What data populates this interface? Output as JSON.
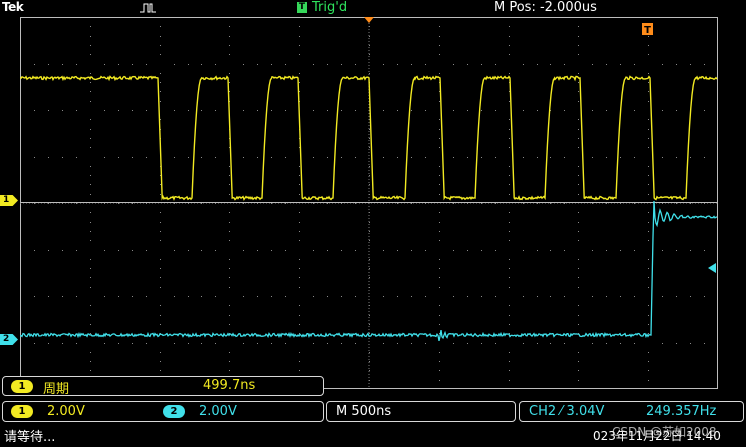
{
  "header": {
    "brand": "Tek",
    "acquisition_icon": "pulse-icon",
    "trigger_badge": "T",
    "trigger_status": "Trig'd",
    "horizontal_position": "M Pos: -2.000us"
  },
  "waveform": {
    "ch1_marker": "1",
    "ch2_marker": "2",
    "trigger_time_marker": "T",
    "ch1_color": "#f2ea22",
    "ch2_color": "#40e0ea"
  },
  "measurement": {
    "channel": "1",
    "label": "周期",
    "value": "499.7ns"
  },
  "channels": {
    "ch1_label": "1",
    "ch1_scale": "2.00V",
    "ch2_label": "2",
    "ch2_scale": "2.00V"
  },
  "timebase": {
    "scale": "M 500ns"
  },
  "trigger": {
    "source": "CH2 ⁄ 3.04V",
    "frequency": "249.357Hz"
  },
  "status": {
    "message": "请等待...",
    "datetime": "023年11月22日 14:40",
    "watermark": "CSDN @苏如2008"
  }
}
